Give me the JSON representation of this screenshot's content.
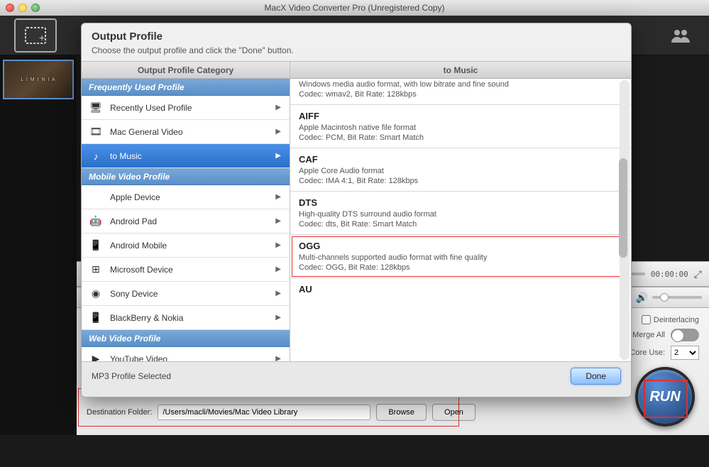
{
  "window": {
    "title": "MacX Video Converter Pro (Unregistered Copy)"
  },
  "thumb_label": "L I M I N I A",
  "player": {
    "time": "00:00:00"
  },
  "options": {
    "deinterlacing": "Deinterlacing",
    "merge_all": "Merge All",
    "core_use_label": "CPU Core Use:",
    "core_value": "2"
  },
  "run_label": "RUN",
  "dest": {
    "label": "Destination Folder:",
    "value": "/Users/macli/Movies/Mac Video Library",
    "browse": "Browse",
    "open": "Open"
  },
  "modal": {
    "title": "Output Profile",
    "subtitle": "Choose the output profile and click the \"Done\" button.",
    "col_left_header": "Output Profile Category",
    "col_right_header": "to Music",
    "sections": {
      "freq": "Frequently Used Profile",
      "mobile": "Mobile Video Profile",
      "web": "Web Video Profile"
    },
    "cats": {
      "recent": "Recently Used Profile",
      "mac": "Mac General Video",
      "music": "to Music",
      "apple": "Apple Device",
      "apad": "Android Pad",
      "amobile": "Android Mobile",
      "ms": "Microsoft Device",
      "sony": "Sony Device",
      "bb": "BlackBerry & Nokia",
      "yt": "YouTube Video"
    },
    "formats": [
      {
        "name": "",
        "desc": "Windows media audio format, with low bitrate and fine sound",
        "codec": "Codec: wmav2, Bit Rate: 128kbps",
        "hi": false,
        "shown": "partial"
      },
      {
        "name": "AIFF",
        "desc": "Apple Macintosh native file format",
        "codec": "Codec: PCM, Bit Rate: Smart Match",
        "hi": false
      },
      {
        "name": "CAF",
        "desc": "Apple Core Audio format",
        "codec": "Codec: IMA 4:1, Bit Rate: 128kbps",
        "hi": false
      },
      {
        "name": "DTS",
        "desc": "High-quality DTS surround audio format",
        "codec": "Codec: dts, Bit Rate: Smart Match",
        "hi": false
      },
      {
        "name": "OGG",
        "desc": "Multi-channels supported audio format with fine quality",
        "codec": "Codec: OGG, Bit Rate: 128kbps",
        "hi": true
      },
      {
        "name": "AU",
        "desc": "",
        "codec": "",
        "hi": false,
        "shown": "partial2"
      }
    ],
    "footer_status": "MP3 Profile Selected",
    "done": "Done"
  }
}
